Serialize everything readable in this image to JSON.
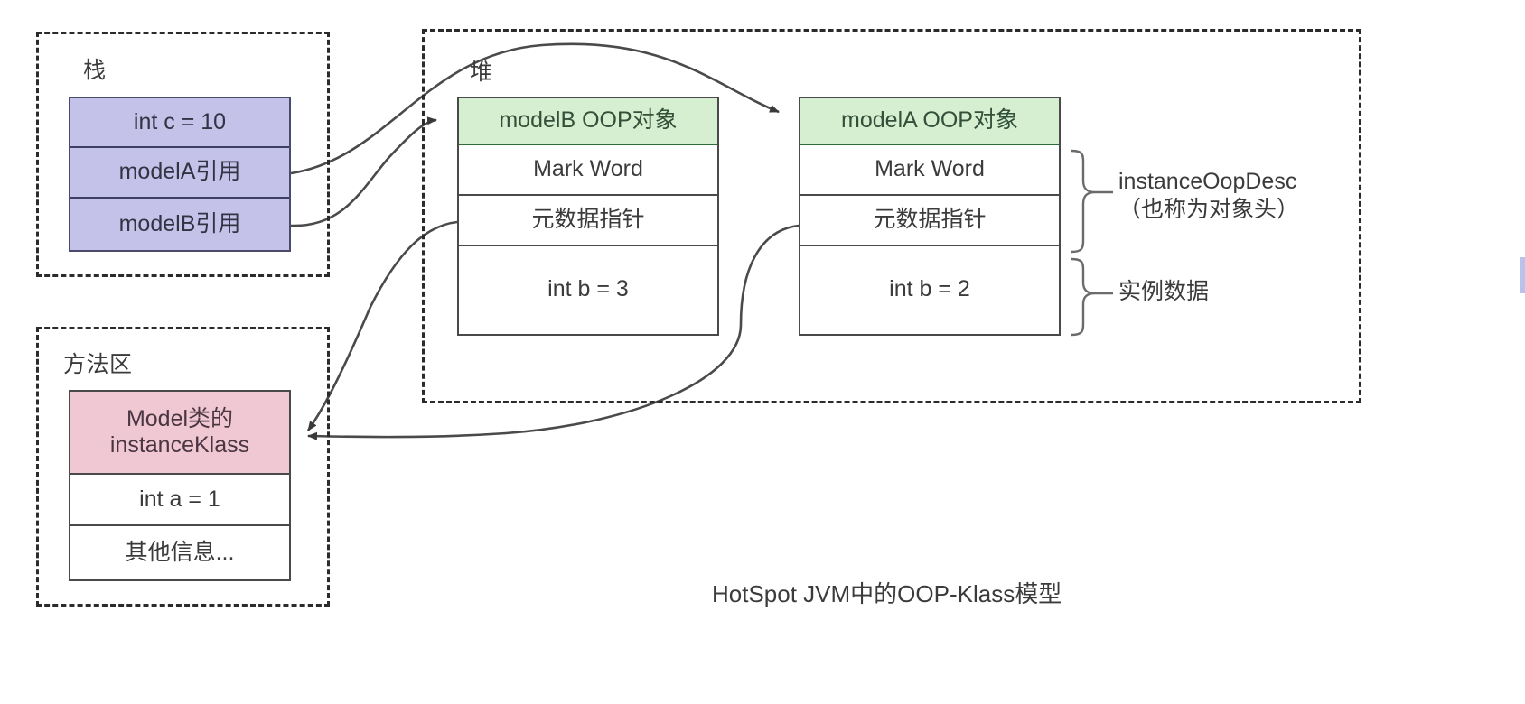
{
  "diagram": {
    "caption": "HotSpot JVM中的OOP-Klass模型",
    "colors": {
      "stack_fill": "#c5c2ea",
      "oop_header_fill": "#d5efd0",
      "klass_header_fill": "#f0c8d4",
      "cell_fill": "#ffffff",
      "border": "#4a4a4a",
      "dashed_border": "#2b2b2b",
      "text": "#3b3b3b"
    }
  },
  "regions": {
    "stack": {
      "label": "栈"
    },
    "heap": {
      "label": "堆"
    },
    "method_area": {
      "label": "方法区"
    }
  },
  "stack_frame": {
    "rows": [
      {
        "text": "int c = 10"
      },
      {
        "text": "modelA引用"
      },
      {
        "text": "modelB引用"
      }
    ]
  },
  "heap_objects": [
    {
      "name": "modelB",
      "rows": [
        {
          "text": "modelB OOP对象",
          "kind": "header"
        },
        {
          "text": "Mark Word",
          "kind": "cell"
        },
        {
          "text": "元数据指针",
          "kind": "cell"
        },
        {
          "text": "int b = 3",
          "kind": "cell"
        }
      ]
    },
    {
      "name": "modelA",
      "rows": [
        {
          "text": "modelA OOP对象",
          "kind": "header"
        },
        {
          "text": "Mark Word",
          "kind": "cell"
        },
        {
          "text": "元数据指针",
          "kind": "cell"
        },
        {
          "text": "int b = 2",
          "kind": "cell"
        }
      ]
    }
  ],
  "method_area_box": {
    "rows": [
      {
        "text": "Model类的\ninstanceKlass",
        "kind": "header"
      },
      {
        "text": "int a = 1",
        "kind": "cell"
      },
      {
        "text": "其他信息...",
        "kind": "cell"
      }
    ]
  },
  "annotations": [
    {
      "id": "object-header",
      "text": "instanceOopDesc\n（也称为对象头）"
    },
    {
      "id": "instance-data",
      "text": "实例数据"
    }
  ]
}
